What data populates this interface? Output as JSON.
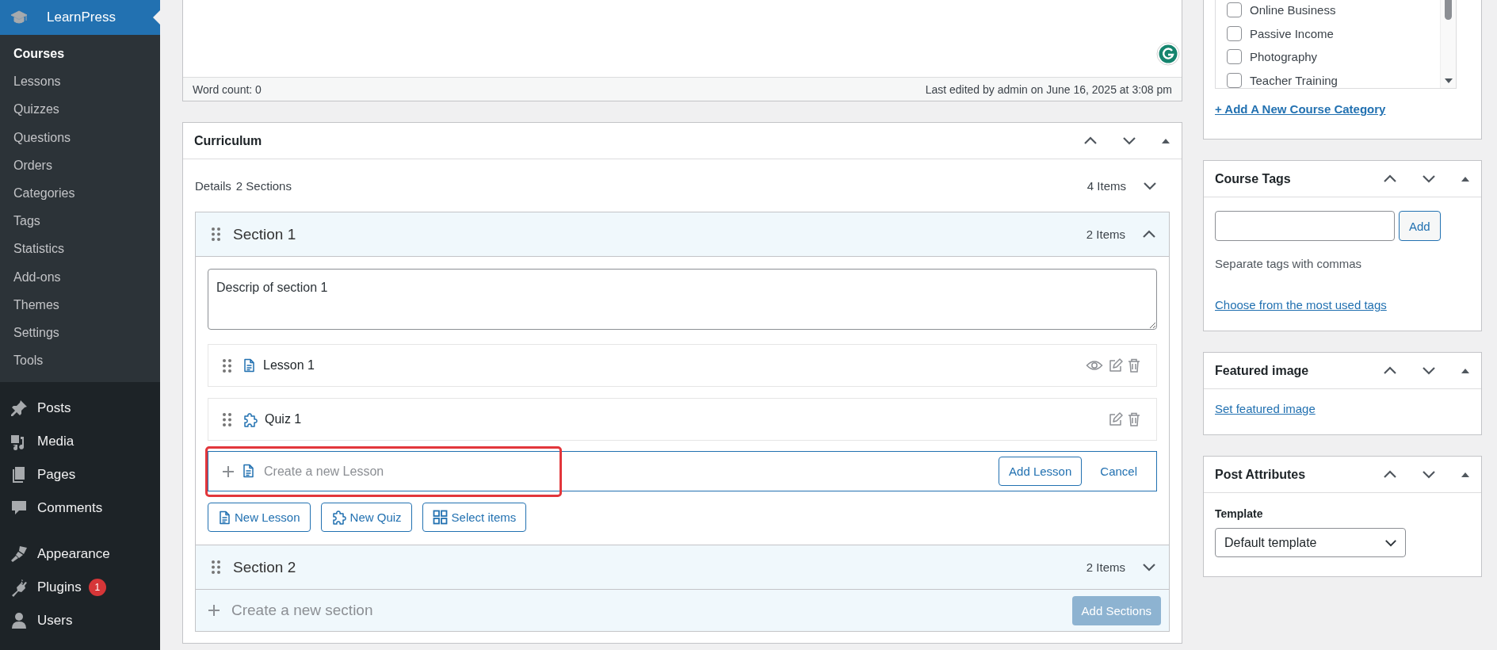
{
  "sidebar": {
    "header": {
      "label": "LearnPress",
      "selected": true
    },
    "submenu": [
      {
        "label": "Courses",
        "selected": true
      },
      {
        "label": "Lessons",
        "selected": false
      },
      {
        "label": "Quizzes",
        "selected": false
      },
      {
        "label": "Questions",
        "selected": false
      },
      {
        "label": "Orders",
        "selected": false
      },
      {
        "label": "Categories",
        "selected": false
      },
      {
        "label": "Tags",
        "selected": false
      },
      {
        "label": "Statistics",
        "selected": false
      },
      {
        "label": "Add-ons",
        "selected": false
      },
      {
        "label": "Themes",
        "selected": false
      },
      {
        "label": "Settings",
        "selected": false
      },
      {
        "label": "Tools",
        "selected": false
      }
    ],
    "menu_groups": [
      [
        {
          "label": "Posts"
        },
        {
          "label": "Media"
        },
        {
          "label": "Pages"
        },
        {
          "label": "Comments"
        }
      ],
      [
        {
          "label": "Appearance"
        },
        {
          "label": "Plugins",
          "badge": "1"
        },
        {
          "label": "Users"
        }
      ]
    ]
  },
  "editor": {
    "word_count": "Word count: 0",
    "last_edited": "Last edited by admin on June 16, 2025 at 3:08 pm"
  },
  "curriculum": {
    "title": "Curriculum",
    "details_label": "Details",
    "sections_count": "2 Sections",
    "items_count": "4 Items",
    "expanded": false,
    "sections": [
      {
        "title": "Section 1",
        "items_count": "2 Items",
        "expanded": true,
        "description": "Descrip of section 1",
        "items": [
          {
            "kind": "lesson",
            "title": "Lesson 1"
          },
          {
            "kind": "quiz",
            "title": "Quiz 1"
          }
        ],
        "new_item": {
          "placeholder": "Create a new Lesson",
          "add_label": "Add Lesson",
          "cancel_label": "Cancel"
        },
        "add_buttons": [
          {
            "kind": "lesson",
            "label": "New Lesson"
          },
          {
            "kind": "quiz",
            "label": "New Quiz"
          },
          {
            "kind": "select",
            "label": "Select items"
          }
        ]
      },
      {
        "title": "Section 2",
        "items_count": "2 Items",
        "expanded": false
      }
    ],
    "new_section": {
      "placeholder": "Create a new section",
      "button": "Add Sections",
      "disabled": true
    }
  },
  "right": {
    "categories": {
      "items": [
        {
          "label": "Online Business",
          "checked": false
        },
        {
          "label": "Passive Income",
          "checked": false
        },
        {
          "label": "Photography",
          "checked": false
        },
        {
          "label": "Teacher Training",
          "checked": false
        }
      ],
      "add_link": "+ Add A New Course Category"
    },
    "tags": {
      "title": "Course Tags",
      "button": "Add",
      "hint": "Separate tags with commas",
      "link": "Choose from the most used tags"
    },
    "featured": {
      "title": "Featured image",
      "link": "Set featured image"
    },
    "attributes": {
      "title": "Post Attributes",
      "template_label": "Template",
      "template_value": "Default template"
    }
  }
}
